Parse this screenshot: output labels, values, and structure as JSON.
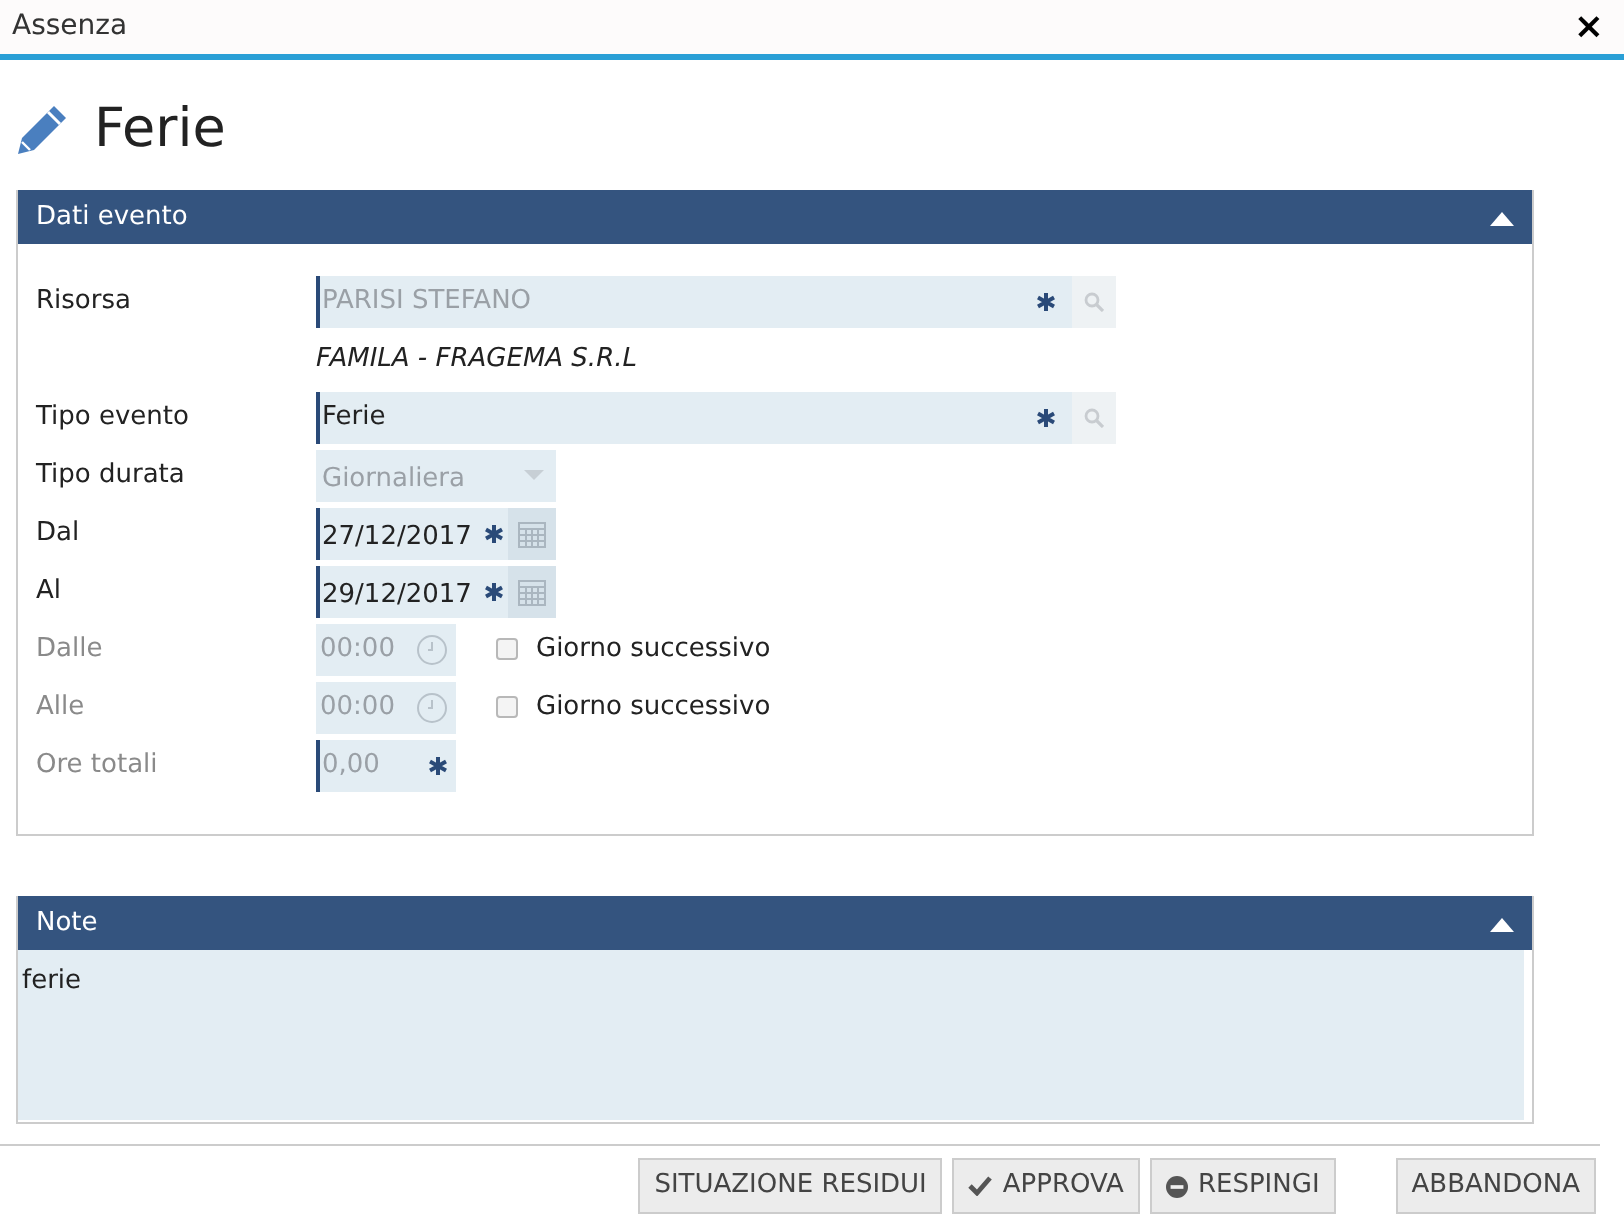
{
  "window": {
    "title": "Assenza",
    "close": "×"
  },
  "heading": "Ferie",
  "event_panel": {
    "title": "Dati evento",
    "expanded": true,
    "fields": [
      {
        "kind": "lookup",
        "label": "Risorsa",
        "value": "PARISI STEFANO",
        "label_disabled": false,
        "disabled": true,
        "required": true
      },
      {
        "kind": "caption",
        "value": "FAMILA - FRAGEMA S.R.L"
      },
      {
        "kind": "lookup",
        "label": "Tipo evento",
        "value": "Ferie",
        "label_disabled": false,
        "disabled": false,
        "required": true
      },
      {
        "kind": "select",
        "label": "Tipo durata",
        "value": "Giornaliera",
        "label_disabled": false,
        "disabled": true,
        "required": false
      },
      {
        "kind": "date",
        "label": "Dal",
        "value": "27/12/2017",
        "label_disabled": false,
        "disabled": false,
        "required": true
      },
      {
        "kind": "date",
        "label": "Al",
        "value": "29/12/2017",
        "label_disabled": false,
        "disabled": false,
        "required": true
      },
      {
        "kind": "time",
        "label": "Dalle",
        "value": "00:00",
        "label_disabled": true,
        "disabled": true,
        "required": false,
        "checkbox": {
          "label": "Giorno successivo",
          "checked": false
        }
      },
      {
        "kind": "time",
        "label": "Alle",
        "value": "00:00",
        "label_disabled": true,
        "disabled": true,
        "required": false,
        "checkbox": {
          "label": "Giorno successivo",
          "checked": false
        }
      },
      {
        "kind": "number",
        "label": "Ore totali",
        "value": "0,00",
        "label_disabled": true,
        "disabled": true,
        "required": true
      }
    ]
  },
  "note_panel": {
    "title": "Note",
    "expanded": true,
    "value": "ferie"
  },
  "buttons": [
    {
      "label": "SITUAZIONE RESIDUI",
      "kind": "plain"
    },
    {
      "label": "APPROVA",
      "kind": "approve"
    },
    {
      "label": "RESPINGI",
      "kind": "reject"
    },
    {
      "label": "ABBANDONA",
      "kind": "plain"
    }
  ]
}
